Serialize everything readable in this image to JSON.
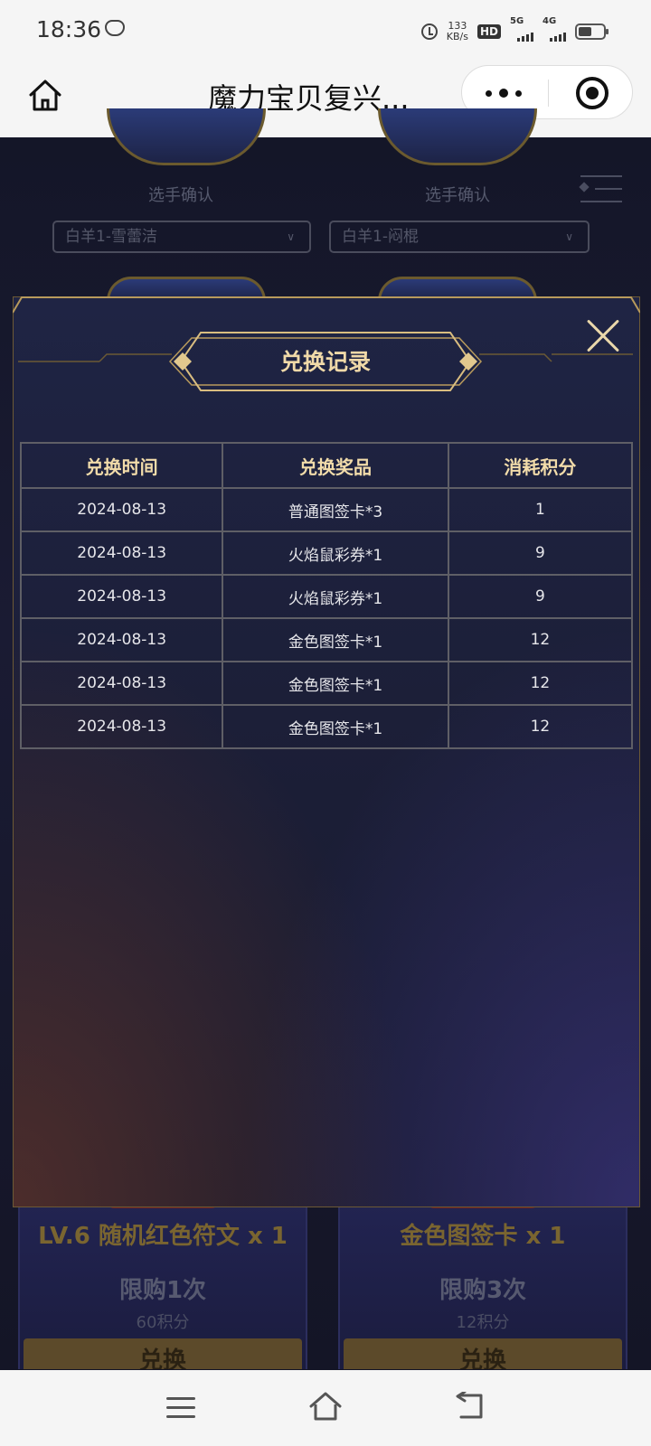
{
  "status_bar": {
    "time": "18:36",
    "net_speed_value": "133",
    "net_speed_unit": "KB/s",
    "hd_label": "HD",
    "sim1_label": "5G",
    "sim2_label": "4G"
  },
  "nav": {
    "title": "魔力宝贝复兴..."
  },
  "background": {
    "players": [
      {
        "label": "选手确认",
        "select_value": "白羊1-雪蕾洁"
      },
      {
        "label": "选手确认",
        "select_value": "白羊1-闷棍"
      }
    ],
    "cards": [
      {
        "title": "LV.6 随机红色符文 x 1",
        "limit": "限购1次",
        "points": "60积分",
        "button": "兑换"
      },
      {
        "title": "金色图签卡 x 1",
        "limit": "限购3次",
        "points": "12积分",
        "button": "兑换"
      }
    ]
  },
  "modal": {
    "title": "兑换记录",
    "columns": [
      "兑换时间",
      "兑换奖品",
      "消耗积分"
    ],
    "rows": [
      [
        "2024-08-13",
        "普通图签卡*3",
        "1"
      ],
      [
        "2024-08-13",
        "火焰鼠彩券*1",
        "9"
      ],
      [
        "2024-08-13",
        "火焰鼠彩券*1",
        "9"
      ],
      [
        "2024-08-13",
        "金色图签卡*1",
        "12"
      ],
      [
        "2024-08-13",
        "金色图签卡*1",
        "12"
      ],
      [
        "2024-08-13",
        "金色图签卡*1",
        "12"
      ]
    ]
  },
  "colors": {
    "gold_accent": "#f0d9a8",
    "modal_bg": "#1c1f38",
    "table_border": "#5f5f66"
  },
  "icons": [
    "home-icon",
    "more-icon",
    "target-icon",
    "close-icon",
    "menu-lines-icon",
    "sys-menu-icon",
    "sys-home-icon",
    "sys-back-icon"
  ]
}
